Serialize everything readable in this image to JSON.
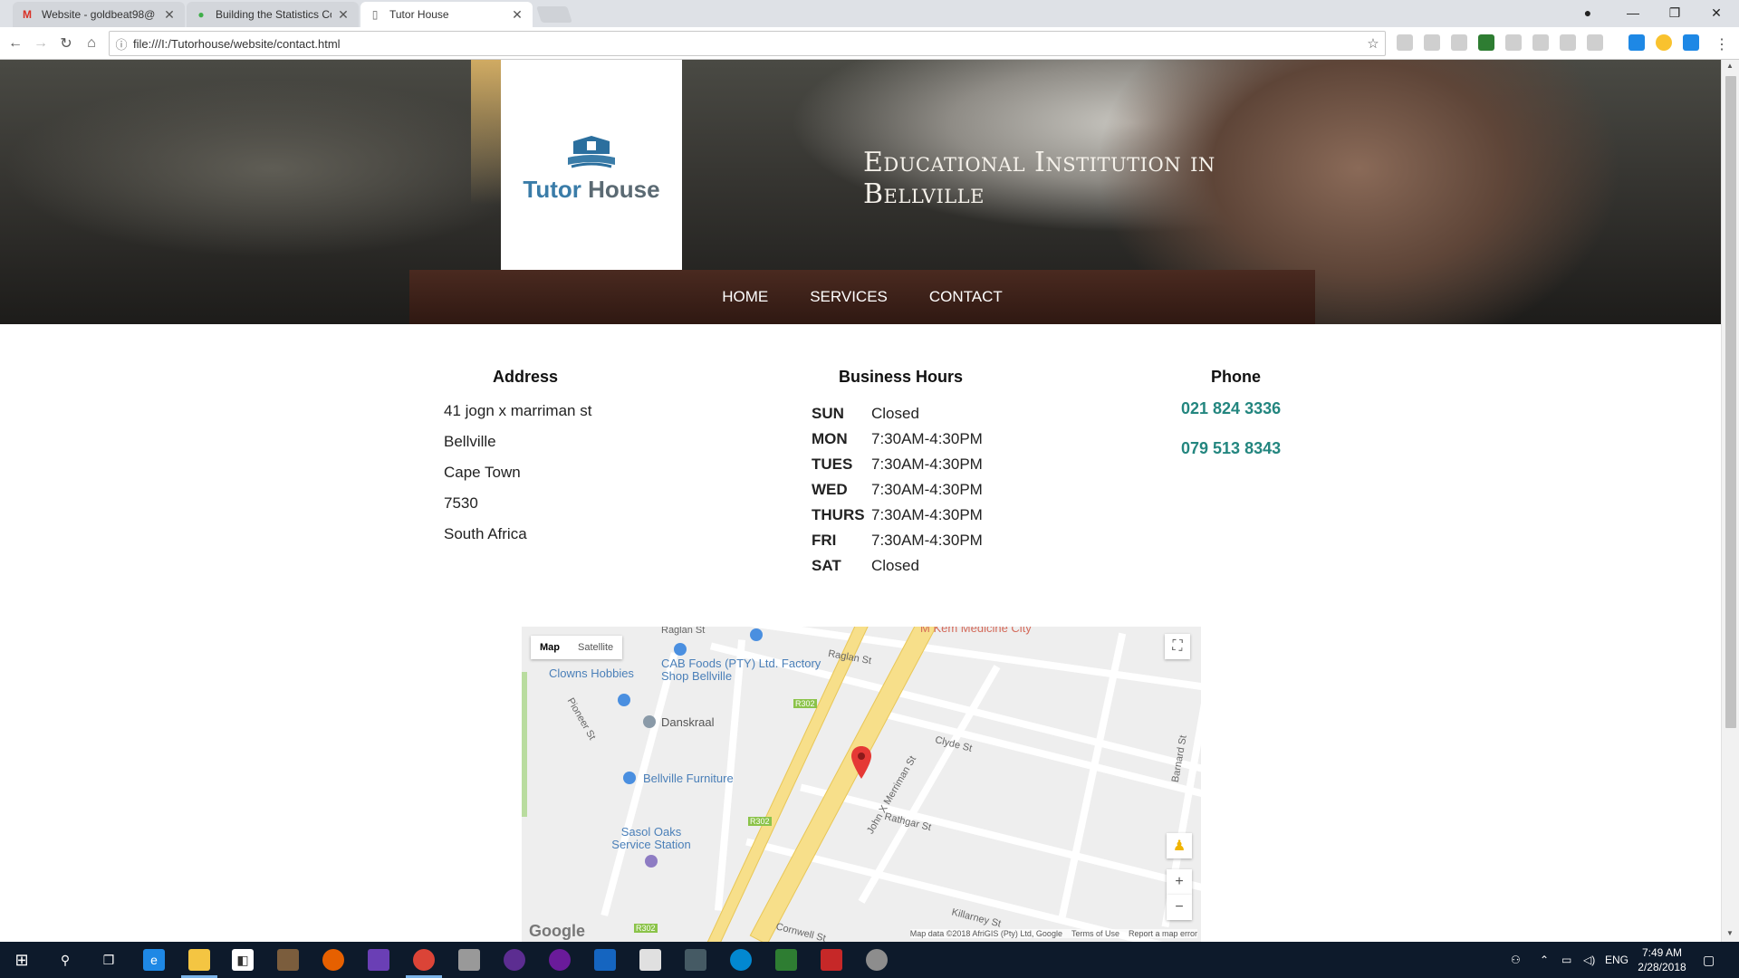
{
  "browser": {
    "tabs": [
      {
        "title": "Website - goldbeat98@",
        "icon": "gmail-icon",
        "active": false
      },
      {
        "title": "Building the Statistics Co",
        "icon": "site-icon",
        "active": false
      },
      {
        "title": "Tutor House",
        "icon": "page-icon",
        "active": true
      }
    ],
    "url": "file:///I:/Tutorhouse/website/contact.html"
  },
  "header": {
    "logo_word1": "Tutor",
    "logo_word2": "House",
    "tagline": "Educational Institution in Bellville"
  },
  "nav": {
    "items": [
      "HOME",
      "SERVICES",
      "CONTACT"
    ]
  },
  "address": {
    "heading": "Address",
    "lines": [
      "41 jogn x marriman st",
      "Bellville",
      "Cape Town",
      "7530",
      "South Africa"
    ]
  },
  "hours": {
    "heading": "Business Hours",
    "rows": [
      {
        "day": "SUN",
        "time": "Closed"
      },
      {
        "day": "MON",
        "time": "7:30AM-4:30PM"
      },
      {
        "day": "TUES",
        "time": "7:30AM-4:30PM"
      },
      {
        "day": "WED",
        "time": "7:30AM-4:30PM"
      },
      {
        "day": "THURS",
        "time": "7:30AM-4:30PM"
      },
      {
        "day": "FRI",
        "time": "7:30AM-4:30PM"
      },
      {
        "day": "SAT",
        "time": "Closed"
      }
    ]
  },
  "phone": {
    "heading": "Phone",
    "numbers": [
      "021 824 3336",
      "079 513 8343"
    ]
  },
  "map": {
    "toggle_map": "Map",
    "toggle_satellite": "Satellite",
    "pois": [
      "Clowns Hobbies",
      "CAB Foods (PTY) Ltd. Factory Shop Bellville",
      "Danskraal",
      "Bellville Furniture",
      "Sasol Oaks Service Station",
      "M Kem Medicine City"
    ],
    "streets": [
      "Raglan St",
      "Raglan St",
      "Pioneer St",
      "Clyde St",
      "John X Merriman St",
      "Rathgar St",
      "Killarney St",
      "Cornwell St",
      "Barnard St",
      "R302",
      "R302",
      "R302"
    ],
    "google": "Google",
    "attribution": [
      "Map data ©2018 AfriGIS (Pty) Ltd, Google",
      "Terms of Use",
      "Report a map error"
    ]
  },
  "taskbar": {
    "language": "ENG",
    "time": "7:49 AM",
    "date": "2/28/2018"
  }
}
